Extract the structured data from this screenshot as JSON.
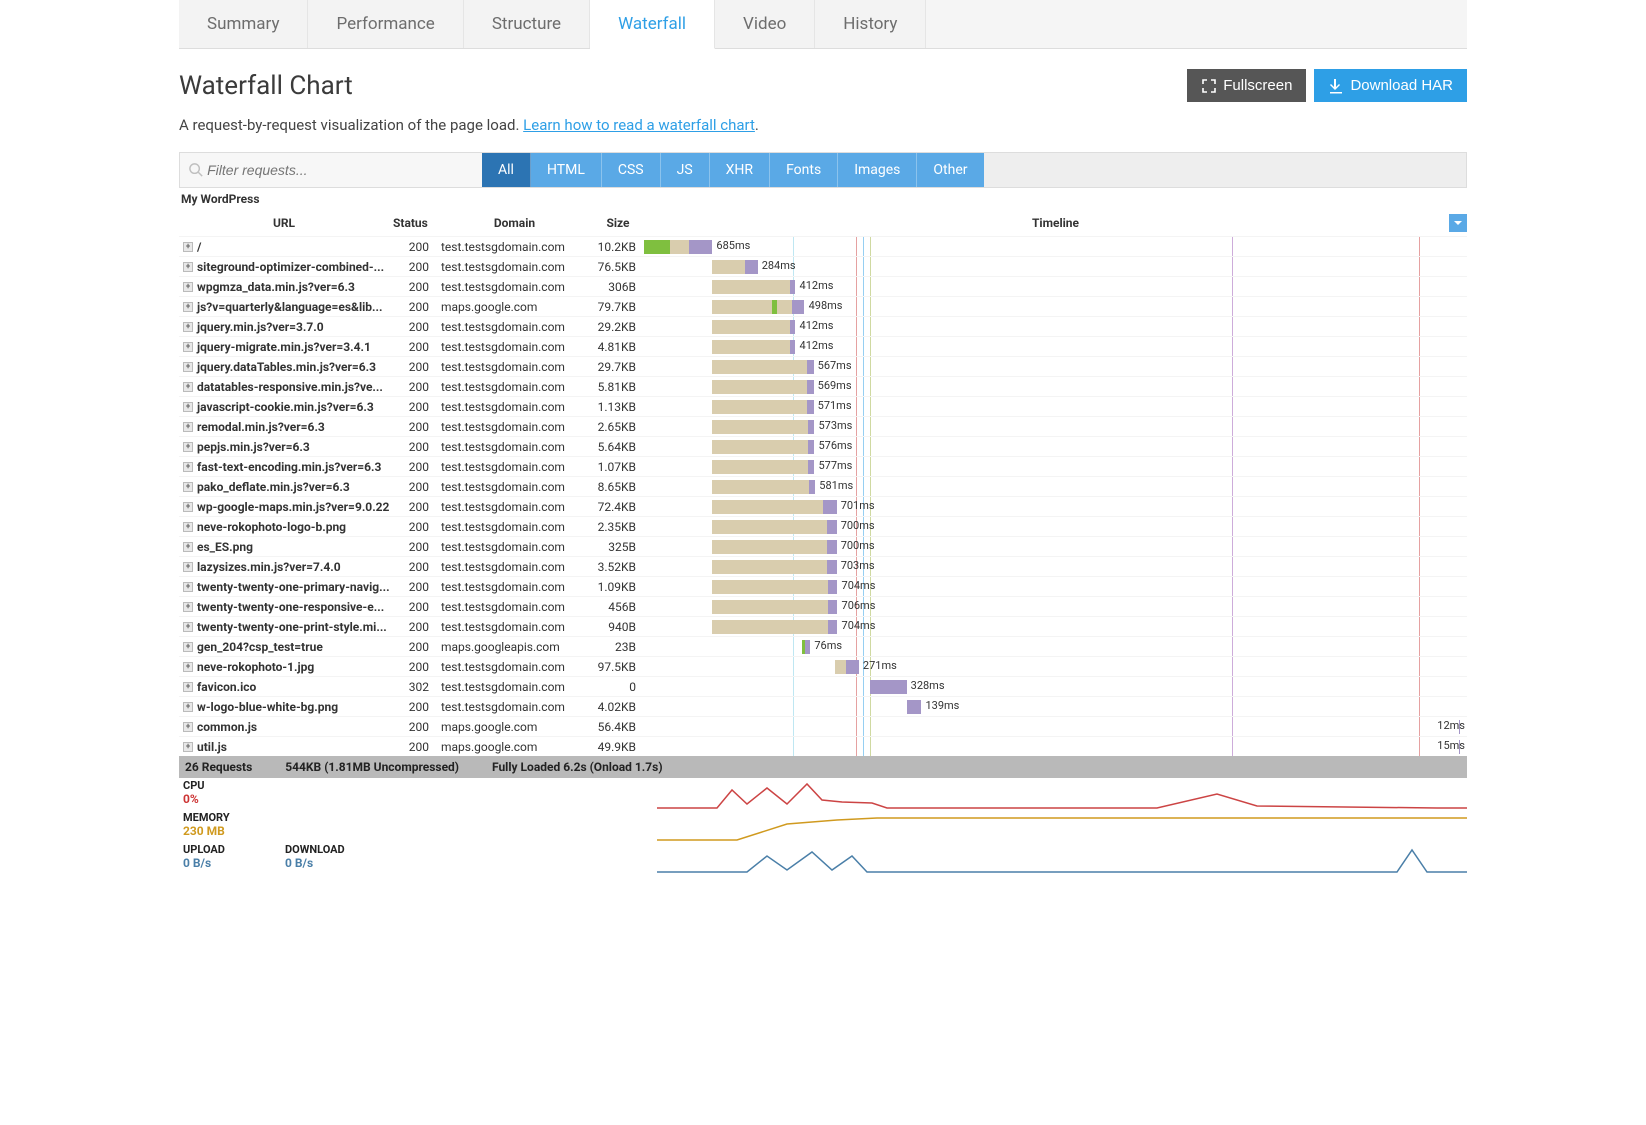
{
  "tabs": [
    "Summary",
    "Performance",
    "Structure",
    "Waterfall",
    "Video",
    "History"
  ],
  "active_tab": 3,
  "page_title": "Waterfall Chart",
  "buttons": {
    "fullscreen": "Fullscreen",
    "download": "Download HAR"
  },
  "description_text": "A request-by-request visualization of the page load. ",
  "description_link": "Learn how to read a waterfall chart",
  "search_placeholder": "Filter requests...",
  "filters": [
    "All",
    "HTML",
    "CSS",
    "JS",
    "XHR",
    "Fonts",
    "Images",
    "Other"
  ],
  "active_filter": 0,
  "site_label": "My WordPress",
  "columns": {
    "url": "URL",
    "status": "Status",
    "domain": "Domain",
    "size": "Size",
    "timeline": "Timeline"
  },
  "timeline_total_ms": 6200,
  "markers": [
    {
      "pos_pct": 18.1,
      "color": "#7fcfe6"
    },
    {
      "pos_pct": 25.8,
      "color": "#c44"
    },
    {
      "pos_pct": 26.6,
      "color": "#2e9fe6"
    },
    {
      "pos_pct": 27.4,
      "color": "#9fb443"
    },
    {
      "pos_pct": 71.5,
      "color": "#9b59b6"
    },
    {
      "pos_pct": 94.2,
      "color": "#c44"
    }
  ],
  "rows": [
    {
      "url": "/",
      "status": 200,
      "domain": "test.testsgdomain.com",
      "size": "10.2KB",
      "dur": "685ms",
      "wait_start": 0,
      "wait_w": 5.5,
      "dns_start": 0,
      "dns_w": 3.2,
      "work_start": 5.5,
      "work_w": 2.8
    },
    {
      "url": "siteground-optimizer-combined-...",
      "status": 200,
      "domain": "test.testsgdomain.com",
      "size": "76.5KB",
      "dur": "284ms",
      "wait_start": 8.3,
      "wait_w": 4.0,
      "work_start": 12.3,
      "work_w": 1.5
    },
    {
      "url": "wpgmza_data.min.js?ver=6.3",
      "status": 200,
      "domain": "test.testsgdomain.com",
      "size": "306B",
      "dur": "412ms",
      "wait_start": 8.3,
      "wait_w": 9.5,
      "work_start": 17.8,
      "work_w": 0.6
    },
    {
      "url": "js?v=quarterly&language=es&lib...",
      "status": 200,
      "domain": "maps.google.com",
      "size": "79.7KB",
      "dur": "498ms",
      "wait_start": 8.3,
      "wait_w": 9.7,
      "dns_start": 15.6,
      "dns_w": 0.6,
      "work_start": 18.0,
      "work_w": 1.5
    },
    {
      "url": "jquery.min.js?ver=3.7.0",
      "status": 200,
      "domain": "test.testsgdomain.com",
      "size": "29.2KB",
      "dur": "412ms",
      "wait_start": 8.3,
      "wait_w": 9.5,
      "work_start": 17.8,
      "work_w": 0.6
    },
    {
      "url": "jquery-migrate.min.js?ver=3.4.1",
      "status": 200,
      "domain": "test.testsgdomain.com",
      "size": "4.81KB",
      "dur": "412ms",
      "wait_start": 8.3,
      "wait_w": 9.5,
      "work_start": 17.8,
      "work_w": 0.6
    },
    {
      "url": "jquery.dataTables.min.js?ver=6.3",
      "status": 200,
      "domain": "test.testsgdomain.com",
      "size": "29.7KB",
      "dur": "567ms",
      "wait_start": 8.3,
      "wait_w": 11.5,
      "work_start": 19.8,
      "work_w": 0.8
    },
    {
      "url": "datatables-responsive.min.js?ve...",
      "status": 200,
      "domain": "test.testsgdomain.com",
      "size": "5.81KB",
      "dur": "569ms",
      "wait_start": 8.3,
      "wait_w": 11.5,
      "work_start": 19.8,
      "work_w": 0.8
    },
    {
      "url": "javascript-cookie.min.js?ver=6.3",
      "status": 200,
      "domain": "test.testsgdomain.com",
      "size": "1.13KB",
      "dur": "571ms",
      "wait_start": 8.3,
      "wait_w": 11.5,
      "work_start": 19.8,
      "work_w": 0.8
    },
    {
      "url": "remodal.min.js?ver=6.3",
      "status": 200,
      "domain": "test.testsgdomain.com",
      "size": "2.65KB",
      "dur": "573ms",
      "wait_start": 8.3,
      "wait_w": 11.6,
      "work_start": 19.9,
      "work_w": 0.8
    },
    {
      "url": "pepjs.min.js?ver=6.3",
      "status": 200,
      "domain": "test.testsgdomain.com",
      "size": "5.64KB",
      "dur": "576ms",
      "wait_start": 8.3,
      "wait_w": 11.6,
      "work_start": 19.9,
      "work_w": 0.8
    },
    {
      "url": "fast-text-encoding.min.js?ver=6.3",
      "status": 200,
      "domain": "test.testsgdomain.com",
      "size": "1.07KB",
      "dur": "577ms",
      "wait_start": 8.3,
      "wait_w": 11.6,
      "work_start": 19.9,
      "work_w": 0.8
    },
    {
      "url": "pako_deflate.min.js?ver=6.3",
      "status": 200,
      "domain": "test.testsgdomain.com",
      "size": "8.65KB",
      "dur": "581ms",
      "wait_start": 8.3,
      "wait_w": 11.7,
      "work_start": 20.0,
      "work_w": 0.8
    },
    {
      "url": "wp-google-maps.min.js?ver=9.0.22",
      "status": 200,
      "domain": "test.testsgdomain.com",
      "size": "72.4KB",
      "dur": "701ms",
      "wait_start": 8.3,
      "wait_w": 13.4,
      "work_start": 21.7,
      "work_w": 1.7
    },
    {
      "url": "neve-rokophoto-logo-b.png",
      "status": 200,
      "domain": "test.testsgdomain.com",
      "size": "2.35KB",
      "dur": "700ms",
      "wait_start": 8.3,
      "wait_w": 13.9,
      "work_start": 22.2,
      "work_w": 1.2
    },
    {
      "url": "es_ES.png",
      "status": 200,
      "domain": "test.testsgdomain.com",
      "size": "325B",
      "dur": "700ms",
      "wait_start": 8.3,
      "wait_w": 13.9,
      "work_start": 22.2,
      "work_w": 1.2
    },
    {
      "url": "lazysizes.min.js?ver=7.4.0",
      "status": 200,
      "domain": "test.testsgdomain.com",
      "size": "3.52KB",
      "dur": "703ms",
      "wait_start": 8.3,
      "wait_w": 13.9,
      "work_start": 22.2,
      "work_w": 1.2
    },
    {
      "url": "twenty-twenty-one-primary-navig...",
      "status": 200,
      "domain": "test.testsgdomain.com",
      "size": "1.09KB",
      "dur": "704ms",
      "wait_start": 8.3,
      "wait_w": 14.0,
      "work_start": 22.3,
      "work_w": 1.2
    },
    {
      "url": "twenty-twenty-one-responsive-e...",
      "status": 200,
      "domain": "test.testsgdomain.com",
      "size": "456B",
      "dur": "706ms",
      "wait_start": 8.3,
      "wait_w": 14.0,
      "work_start": 22.3,
      "work_w": 1.2
    },
    {
      "url": "twenty-twenty-one-print-style.mi...",
      "status": 200,
      "domain": "test.testsgdomain.com",
      "size": "940B",
      "dur": "704ms",
      "wait_start": 8.3,
      "wait_w": 14.0,
      "work_start": 22.3,
      "work_w": 1.2
    },
    {
      "url": "gen_204?csp_test=true",
      "status": 200,
      "domain": "maps.googleapis.com",
      "size": "23B",
      "dur": "76ms",
      "wait_start": 19.2,
      "wait_w": 0.4,
      "dns_start": 19.2,
      "dns_w": 0.4,
      "work_start": 19.6,
      "work_w": 0.6
    },
    {
      "url": "neve-rokophoto-1.jpg",
      "status": 200,
      "domain": "test.testsgdomain.com",
      "size": "97.5KB",
      "dur": "271ms",
      "wait_start": 23.2,
      "wait_w": 1.4,
      "work_start": 24.6,
      "work_w": 1.5
    },
    {
      "url": "favicon.ico",
      "status": 302,
      "domain": "test.testsgdomain.com",
      "size": "0",
      "dur": "328ms",
      "wait_start": 27.4,
      "wait_w": 0,
      "work_start": 27.4,
      "work_w": 4.5
    },
    {
      "url": "w-logo-blue-white-bg.png",
      "status": 200,
      "domain": "test.testsgdomain.com",
      "size": "4.02KB",
      "dur": "139ms",
      "wait_start": 32.0,
      "wait_w": 0,
      "work_start": 32.0,
      "work_w": 1.7
    },
    {
      "url": "common.js",
      "status": 200,
      "domain": "maps.google.com",
      "size": "56.4KB",
      "dur": "12ms",
      "wait_start": 99,
      "wait_w": 0,
      "work_start": 99,
      "work_w": 0.15,
      "label_right": true
    },
    {
      "url": "util.js",
      "status": 200,
      "domain": "maps.google.com",
      "size": "49.9KB",
      "dur": "15ms",
      "wait_start": 99,
      "wait_w": 0,
      "work_start": 99,
      "work_w": 0.2,
      "label_right": true
    }
  ],
  "summary": {
    "requests": "26 Requests",
    "size": "544KB  (1.81MB Uncompressed)",
    "load": "Fully Loaded 6.2s  (Onload 1.7s)"
  },
  "metrics": {
    "cpu": {
      "label": "CPU",
      "value": "0%",
      "color": "val-red"
    },
    "memory": {
      "label": "MEMORY",
      "value": "230 MB",
      "color": "val-gold"
    },
    "net": {
      "upload_label": "UPLOAD",
      "upload_value": "0 B/s",
      "download_label": "DOWNLOAD",
      "download_value": "0 B/s"
    }
  }
}
